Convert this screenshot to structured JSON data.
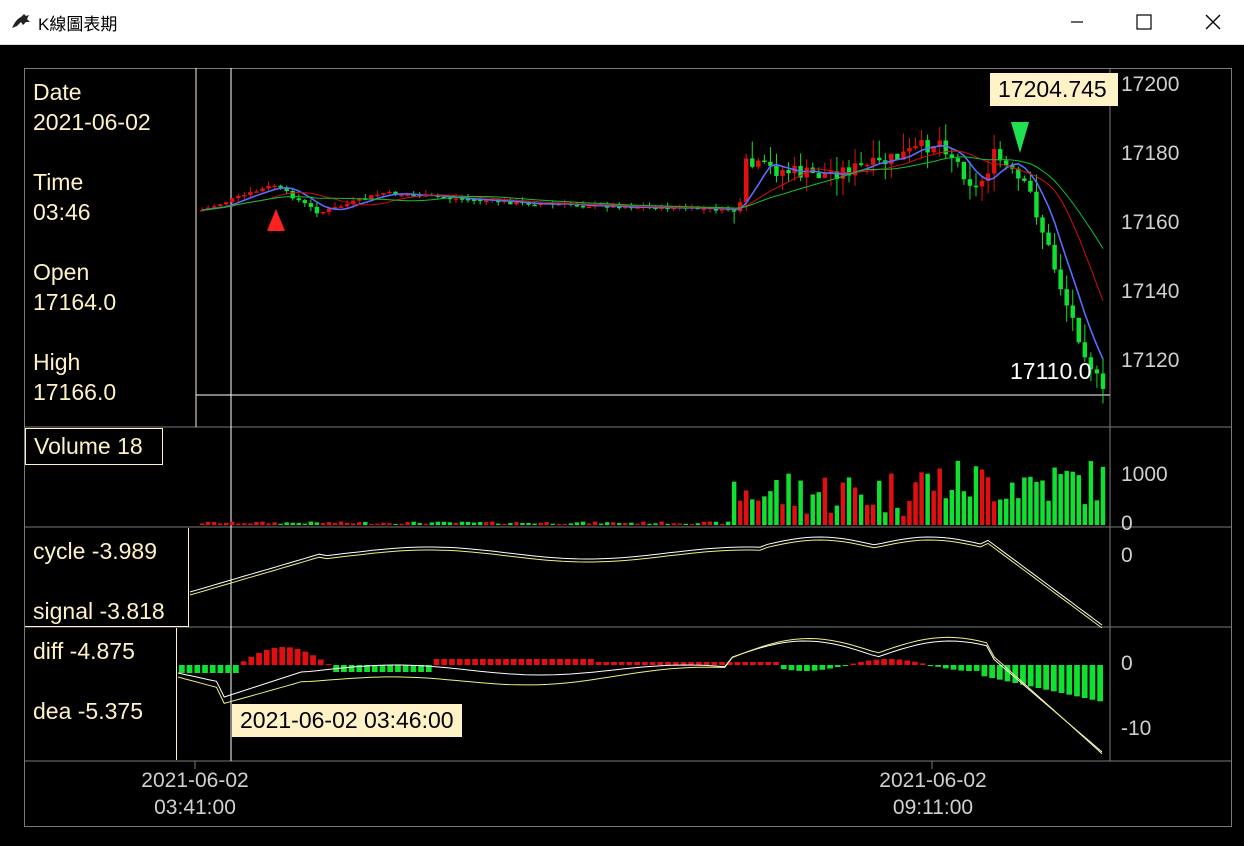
{
  "window": {
    "title": "K線圖表期"
  },
  "info": {
    "date_label": "Date",
    "date_value": "2021-06-02",
    "time_label": "Time",
    "time_value": "03:46",
    "open_label": "Open",
    "open_value": "17164.0",
    "high_label": "High",
    "high_value": "17166.0"
  },
  "volume_label": "Volume 18",
  "cycle_label": "cycle -3.989",
  "signal_label": "signal -3.818",
  "diff_label": "diff -4.875",
  "dea_label": "dea -5.375",
  "price_marker_high": "17204.745",
  "price_marker_low": "17110.0",
  "crosshair_time_tag": "2021-06-02 03:46:00",
  "price_axis_ticks": [
    "17200",
    "17180",
    "17160",
    "17140",
    "17120"
  ],
  "volume_axis_ticks": [
    "1000",
    "0"
  ],
  "cycle_axis_ticks": [
    "0"
  ],
  "macd_axis_ticks": [
    "0",
    "-10"
  ],
  "time_axis": [
    {
      "date": "2021-06-02",
      "time": "03:41:00"
    },
    {
      "date": "2021-06-02",
      "time": "09:11:00"
    }
  ],
  "colors": {
    "up": "#e01010",
    "down": "#10e030",
    "label": "#fff2c6",
    "ma_fast": "#5a6cff",
    "ma_mid": "#d01010",
    "ma_slow": "#10c030"
  }
}
